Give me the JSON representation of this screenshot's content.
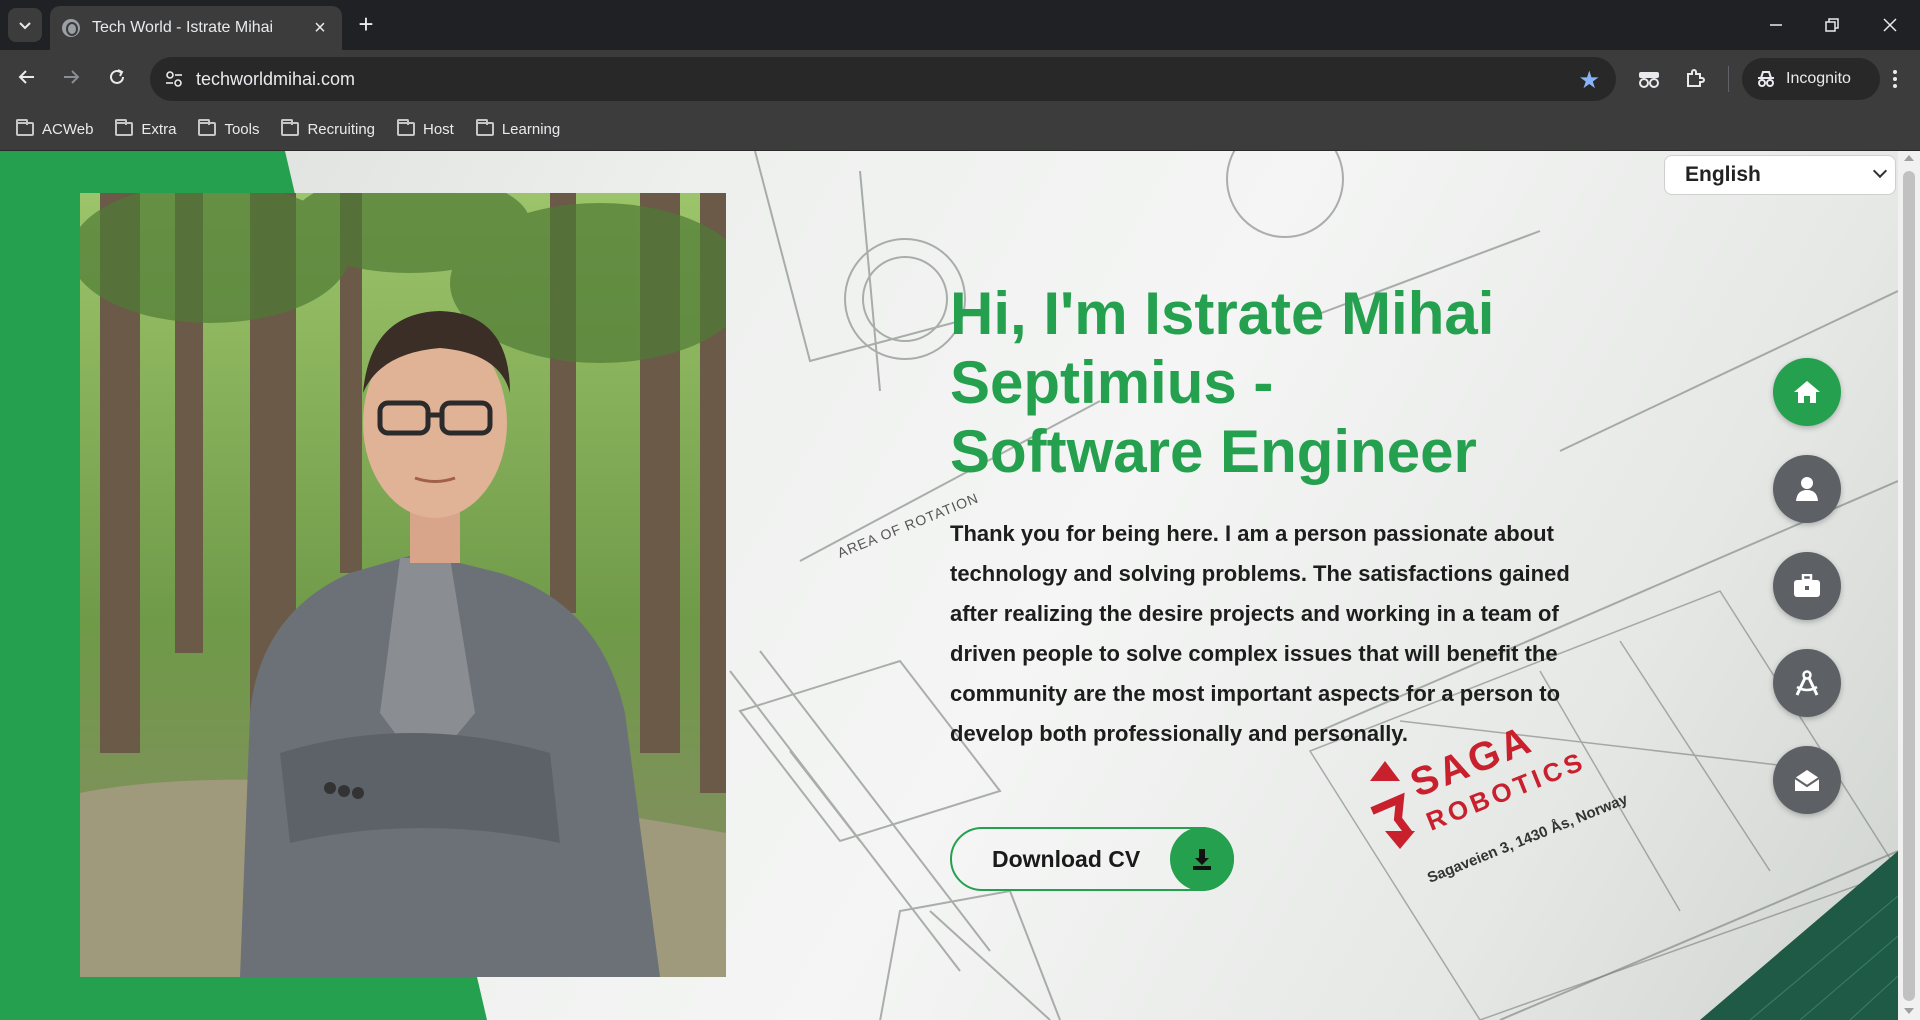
{
  "browser": {
    "tab_title": "Tech World - Istrate Mihai",
    "url": "techworldmihai.com",
    "incognito_label": "Incognito",
    "bookmarks": [
      "ACWeb",
      "Extra",
      "Tools",
      "Recruiting",
      "Host",
      "Learning"
    ]
  },
  "page": {
    "language_selected": "English",
    "hero": {
      "title_line1": "Hi, I'm Istrate Mihai",
      "title_line2": "Septimius -",
      "title_line3": "Software Engineer",
      "description": "Thank you for being here. I am a person passionate about technology and solving problems. The satisfactions gained after realizing the desire projects and working in a team of driven people to solve complex issues that will benefit the community are the most important aspects for a person to develop both professionally and personally."
    },
    "download_cv_label": "Download CV",
    "nav_icons": [
      "home-icon",
      "user-icon",
      "briefcase-icon",
      "compass-tools-icon",
      "envelope-open-icon"
    ],
    "colors": {
      "accent": "#25a04f",
      "fab_idle": "#5d6166",
      "text": "#1d1d1d"
    },
    "background_text": {
      "logo_line1": "SAGA",
      "logo_line2": "ROBOTICS",
      "address": "Sagaveien 3, 1430 Ås, Norway",
      "area_label": "AREA OF ROTATION"
    }
  }
}
